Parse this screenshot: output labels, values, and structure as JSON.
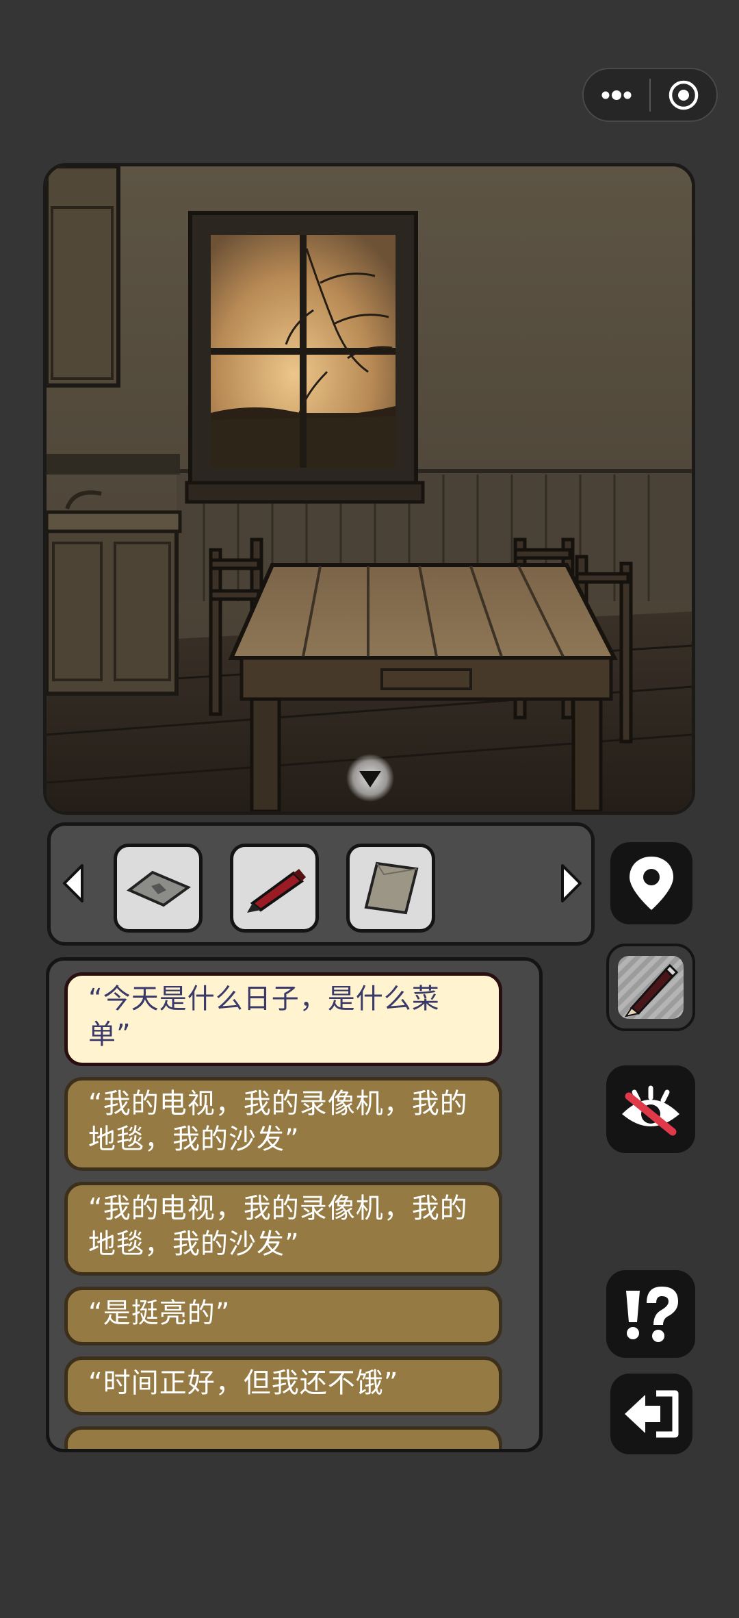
{
  "capsule": {
    "more_icon": "more-dots-icon",
    "close_icon": "target-circle-icon"
  },
  "scene": {
    "description_icon": "kitchen-scene",
    "toggle_icon": "triangle-down-icon"
  },
  "inventory": {
    "items": [
      {
        "icon": "tile-icon"
      },
      {
        "icon": "pen-icon"
      },
      {
        "icon": "paper-icon"
      }
    ]
  },
  "dialogue": {
    "options": [
      {
        "text": "“今天是什么日子，是什么菜单”",
        "selected": true
      },
      {
        "text": "“我的电视，我的录像机，我的地毯，我的沙发”",
        "selected": false
      },
      {
        "text": "“我的电视，我的录像机，我的地毯，我的沙发”",
        "selected": false
      },
      {
        "text": "“是挺亮的”",
        "selected": false
      },
      {
        "text": "“时间正好，但我还不饿”",
        "selected": false
      }
    ]
  },
  "side": {
    "map_icon": "map-pin-icon",
    "note_icon": "pencil-icon",
    "eye_icon": "eye-crossed-icon",
    "hint_icon": "hint-icon",
    "back_icon": "exit-icon"
  }
}
